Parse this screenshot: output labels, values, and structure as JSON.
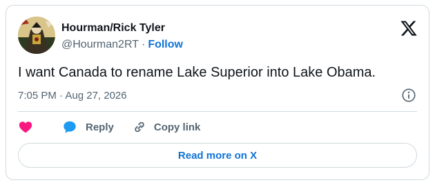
{
  "author": {
    "display_name": "Hourman/Rick Tyler",
    "handle": "@Hourman2RT",
    "separator": "·",
    "follow_label": "Follow"
  },
  "tweet": {
    "text": "I want Canada to rename Lake Superior into Lake Obama.",
    "timestamp": "7:05 PM · Aug 27, 2026"
  },
  "actions": {
    "like_icon": "heart-icon",
    "reply_label": "Reply",
    "reply_icon": "speech-bubble-icon",
    "copy_link_label": "Copy link",
    "copy_link_icon": "link-icon"
  },
  "footer": {
    "read_more_label": "Read more on X"
  },
  "colors": {
    "accent": "#0f73d6",
    "like": "#f91880",
    "reply": "#1d9bf0",
    "text": "#0f1419",
    "secondary": "#536471",
    "border": "#cfd9de"
  }
}
